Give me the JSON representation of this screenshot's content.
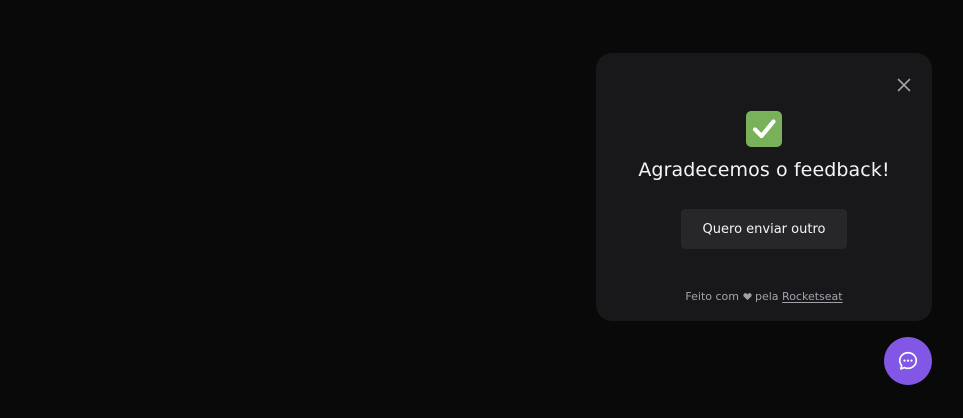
{
  "feedback_widget": {
    "success_icon": "check-mark-button-emoji",
    "title": "Agradecemos o feedback!",
    "send_another_label": "Quero enviar outro",
    "close_icon": "close-icon",
    "footer": {
      "prefix": "Feito com",
      "heart_icon": "heart-icon",
      "middle": "pela",
      "link_text": "Rocketseat"
    }
  },
  "fab": {
    "icon": "chat-bubble-icon"
  },
  "colors": {
    "page_background": "#09090a",
    "widget_background": "#18181b",
    "button_background": "#27272a",
    "brand": "#8257e5",
    "check_green": "#78b159",
    "text_primary": "#f4f4f5",
    "text_secondary": "#a1a1aa"
  }
}
